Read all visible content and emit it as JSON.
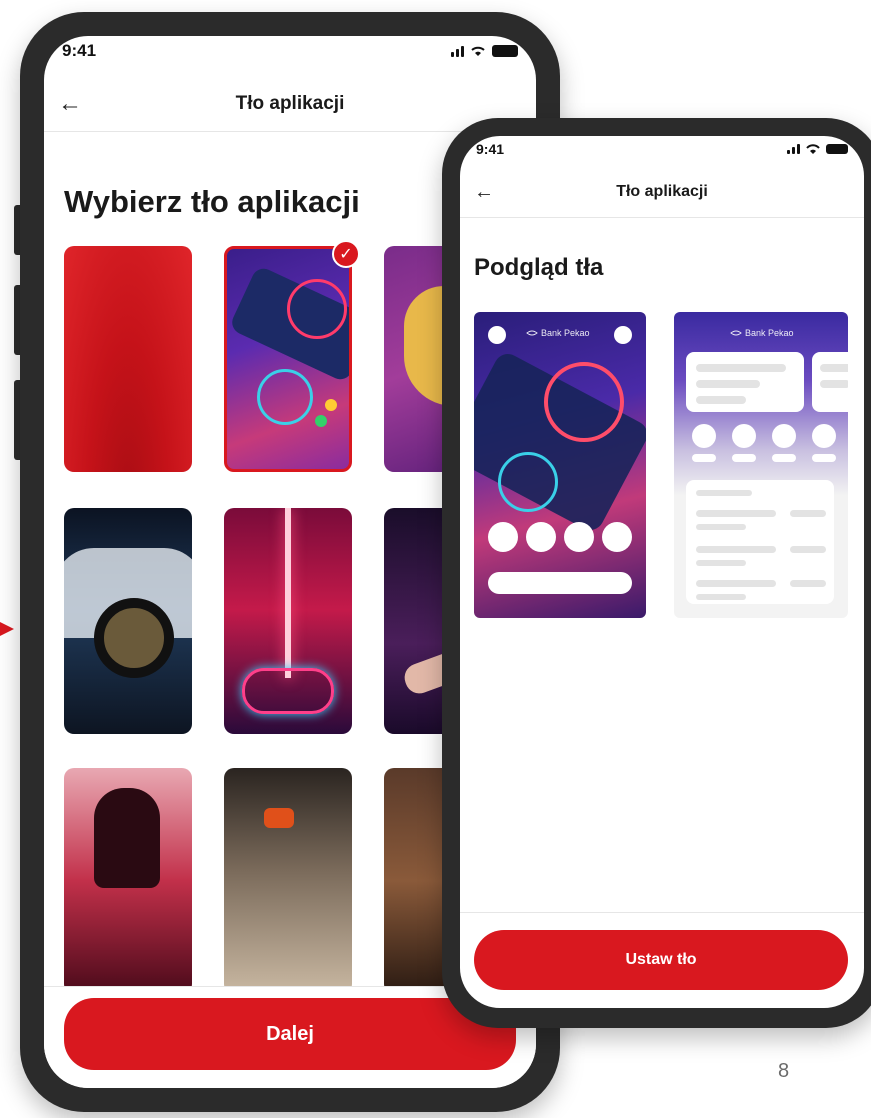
{
  "phone_left": {
    "status_time": "9:41",
    "nav_title": "Tło aplikacji",
    "heading": "Wybierz tło aplikacji",
    "next_button": "Dalej"
  },
  "phone_right": {
    "status_time": "9:41",
    "nav_title": "Tło aplikacji",
    "heading": "Podgląd tła",
    "brand_label": "Bank Pekao",
    "set_button": "Ustaw tło"
  },
  "page_number": "8",
  "colors": {
    "accent": "#d9181f",
    "phone_frame": "#2b2b2b"
  }
}
